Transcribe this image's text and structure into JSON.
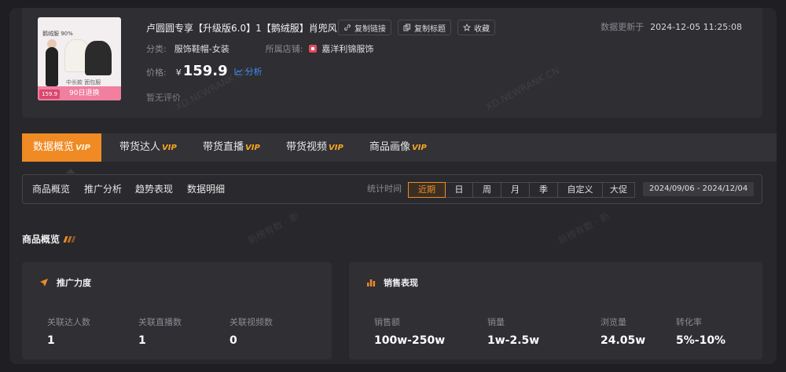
{
  "product": {
    "title": "卢圆圆专享【升级版6.0】1【鹅绒服】肖兜风...",
    "thumb_tag": "鹅绒服 90%",
    "thumb_sub": "中长款 面包服",
    "thumb_price": "159.9",
    "thumb_promo": "90日退换",
    "copy_link": "复制链接",
    "copy_title": "复制标题",
    "favorite": "收藏",
    "update_label": "数据更新于",
    "update_time": "2024-12-05 11:25:08",
    "category_label": "分类:",
    "category_value": "服饰鞋帽-女装",
    "shop_label": "所属店铺:",
    "shop_value": "嘉洋利锦服饰",
    "price_label": "价格:",
    "price_currency": "¥",
    "price_value": "159.9",
    "analysis_label": "分析",
    "review_text": "暂无评价"
  },
  "watermarks": [
    "XD.NEWRANK.CN",
    "XD.NEWRANK.CN",
    "新榜有数 · 新",
    "新榜有数 · 新"
  ],
  "main_tabs": [
    {
      "label": "数据概览",
      "vip": "VIP"
    },
    {
      "label": "带货达人",
      "vip": "VIP"
    },
    {
      "label": "带货直播",
      "vip": "VIP"
    },
    {
      "label": "带货视频",
      "vip": "VIP"
    },
    {
      "label": "商品画像",
      "vip": "VIP"
    }
  ],
  "sub_nav": [
    "商品概览",
    "推广分析",
    "趋势表现",
    "数据明细"
  ],
  "stat_time_label": "统计时间",
  "periods": [
    "近期",
    "日",
    "周",
    "月",
    "季",
    "自定义",
    "大促"
  ],
  "date_range": "2024/09/06 - 2024/12/04",
  "section_title": "商品概览",
  "promo_card": {
    "title": "推广力度",
    "metrics": [
      {
        "label": "关联达人数",
        "value": "1"
      },
      {
        "label": "关联直播数",
        "value": "1"
      },
      {
        "label": "关联视频数",
        "value": "0"
      }
    ]
  },
  "sales_card": {
    "title": "销售表现",
    "metrics": [
      {
        "label": "销售额",
        "value": "100w-250w"
      },
      {
        "label": "销量",
        "value": "1w-2.5w"
      },
      {
        "label": "浏览量",
        "value": "24.05w"
      },
      {
        "label": "转化率",
        "value": "5%-10%"
      }
    ]
  },
  "colors": {
    "accent": "#f08a24",
    "link": "#3b8ef0",
    "vip": "#f5a623"
  }
}
